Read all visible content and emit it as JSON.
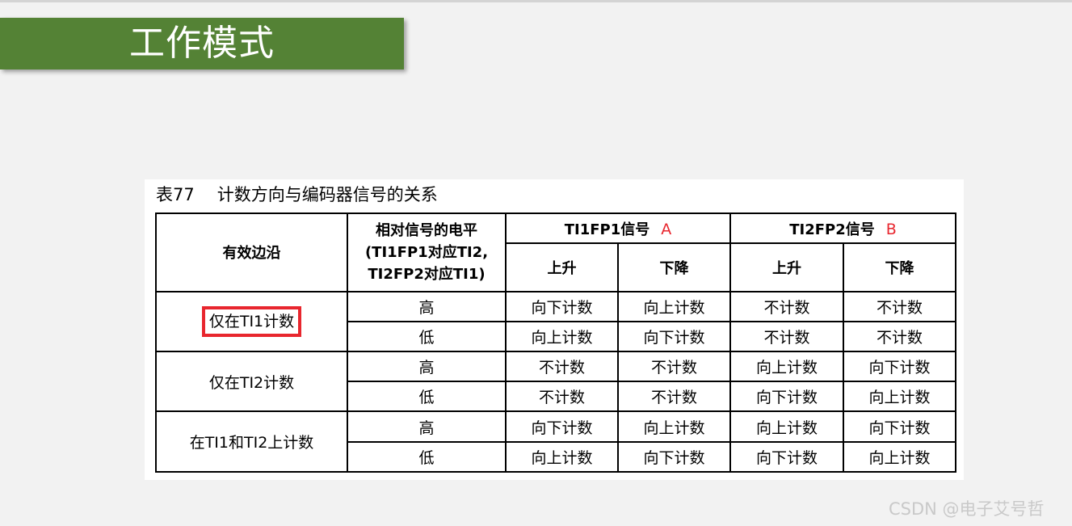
{
  "slide": {
    "title": "工作模式",
    "accent_color": "#548235"
  },
  "table_caption": {
    "number": "表77",
    "text": "计数方向与编码器信号的关系"
  },
  "table": {
    "header": {
      "edge": "有效边沿",
      "level_lines": [
        "相对信号的电平",
        "(TI1FP1对应TI2,",
        "TI2FP2对应TI1)"
      ],
      "ti1fp1": "TI1FP1信号",
      "ti1fp1_marker": "A",
      "ti2fp2": "TI2FP2信号",
      "ti2fp2_marker": "B",
      "rise": "上升",
      "fall": "下降"
    },
    "groups": [
      {
        "edge": "仅在TI1计数",
        "highlighted": true,
        "rows": [
          {
            "level": "高",
            "ti1_rise": "向下计数",
            "ti1_fall": "向上计数",
            "ti2_rise": "不计数",
            "ti2_fall": "不计数"
          },
          {
            "level": "低",
            "ti1_rise": "向上计数",
            "ti1_fall": "向下计数",
            "ti2_rise": "不计数",
            "ti2_fall": "不计数"
          }
        ]
      },
      {
        "edge": "仅在TI2计数",
        "highlighted": false,
        "rows": [
          {
            "level": "高",
            "ti1_rise": "不计数",
            "ti1_fall": "不计数",
            "ti2_rise": "向上计数",
            "ti2_fall": "向下计数"
          },
          {
            "level": "低",
            "ti1_rise": "不计数",
            "ti1_fall": "不计数",
            "ti2_rise": "向下计数",
            "ti2_fall": "向上计数"
          }
        ]
      },
      {
        "edge": "在TI1和TI2上计数",
        "highlighted": false,
        "rows": [
          {
            "level": "高",
            "ti1_rise": "向下计数",
            "ti1_fall": "向上计数",
            "ti2_rise": "向上计数",
            "ti2_fall": "向下计数"
          },
          {
            "level": "低",
            "ti1_rise": "向上计数",
            "ti1_fall": "向下计数",
            "ti2_rise": "向下计数",
            "ti2_fall": "向上计数"
          }
        ]
      }
    ]
  },
  "highlight_color": "#e8262e",
  "watermark": "CSDN @电子艾号哲"
}
